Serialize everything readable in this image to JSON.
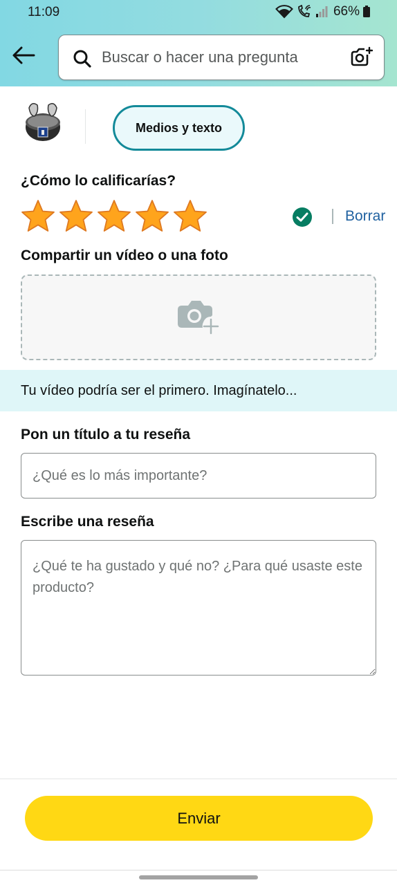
{
  "status_bar": {
    "time": "11:09",
    "battery": "66%",
    "icons": [
      "wifi-icon",
      "wifi-calling-icon",
      "signal-icon",
      "battery-icon"
    ]
  },
  "header": {
    "back_icon": "arrow-left-icon",
    "search_placeholder": "Buscar o hacer una pregunta",
    "search_icon": "search-icon",
    "camera_icon": "camera-search-icon"
  },
  "product": {
    "thumbnail_icon": "earbuds-product-icon",
    "media_tab_label": "Medios y texto"
  },
  "rating": {
    "question": "¿Cómo lo calificarías?",
    "stars_selected": 5,
    "stars_total": 5,
    "clear_label": "Borrar"
  },
  "media": {
    "share_label": "Compartir un vídeo o una foto",
    "upload_icon": "add-photo-icon",
    "banner_text": "Tu vídeo podría ser el primero. Imagínatelo..."
  },
  "review_title": {
    "label": "Pon un título a tu reseña",
    "placeholder": "¿Qué es lo más importante?"
  },
  "review_body": {
    "label": "Escribe una reseña",
    "placeholder": "¿Qué te ha gustado y qué no? ¿Para qué usaste este producto?"
  },
  "submit_label": "Enviar",
  "colors": {
    "accent": "#138a99",
    "submit": "#ffd814",
    "star": "#ffa41c",
    "link": "#2162a1",
    "check": "#067d62"
  }
}
